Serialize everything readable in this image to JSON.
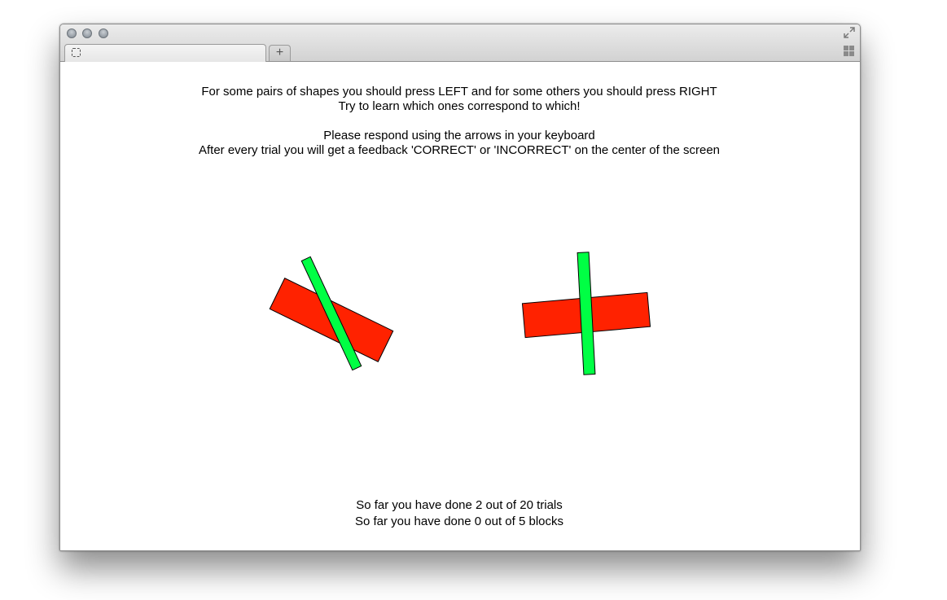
{
  "window": {
    "tab_title": "",
    "new_tab_label": "+"
  },
  "instructions": {
    "line1": "For some pairs of shapes you should press LEFT and for some others you should press RIGHT",
    "line2": "Try to learn which ones correspond to which!",
    "line3": "Please respond using the arrows in your keyboard",
    "line4": "After every trial you will get a feedback 'CORRECT' or 'INCORRECT' on the center of the screen"
  },
  "stimuli": {
    "colors": {
      "bar_large": "#ff2200",
      "bar_thin": "#00ff44",
      "outline": "#000000"
    },
    "left_pair": {
      "large_bar_angle_deg": 26,
      "thin_bar_angle_deg": -25
    },
    "right_pair": {
      "large_bar_angle_deg": -5,
      "thin_bar_angle_deg": -3
    }
  },
  "progress": {
    "trials_text": "So far you have done 2 out of 20 trials",
    "blocks_text": "So far you have done 0 out of 5 blocks"
  }
}
